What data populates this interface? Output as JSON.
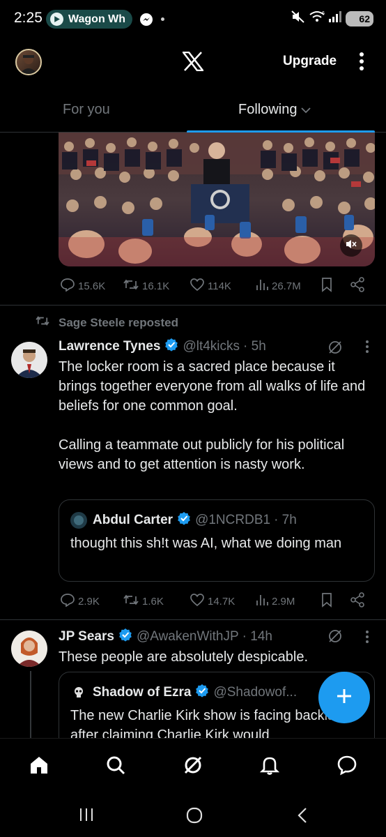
{
  "status_bar": {
    "time": "2:25",
    "app_pill_text": "Wagon Wh",
    "network": "6",
    "battery": "62"
  },
  "header": {
    "logo": "x-logo-icon",
    "upgrade_label": "Upgrade"
  },
  "tabs": [
    {
      "label": "For you",
      "active": false
    },
    {
      "label": "Following",
      "active": true
    }
  ],
  "post1": {
    "stats": {
      "replies": "15.6K",
      "reposts": "16.1K",
      "likes": "114K",
      "views": "26.7M"
    }
  },
  "post2": {
    "repost_label": "Sage Steele reposted",
    "name": "Lawrence Tynes",
    "handle": "@lt4kicks",
    "time": "· 5h",
    "text_p1": "The locker room is a sacred place because it brings together everyone from all walks of life and beliefs for one common goal.",
    "text_p2": "Calling a teammate out publicly for his political views and to get attention is nasty work.",
    "quote": {
      "name": "Abdul Carter",
      "handle": "@1NCRDB1",
      "time": "· 7h",
      "text": "thought this sh!t was AI, what we doing man"
    },
    "stats": {
      "replies": "2.9K",
      "reposts": "1.6K",
      "likes": "14.7K",
      "views": "2.9M"
    }
  },
  "post3": {
    "name": "JP Sears",
    "handle": "@AwakenWithJP",
    "time": "· 14h",
    "text": "These people are absolutely despicable.",
    "quote": {
      "name": "Shadow of Ezra",
      "handle": "@Shadowof...",
      "text": "The new Charlie Kirk show is facing backlash after claiming Charlie Kirk would"
    }
  },
  "colors": {
    "accent": "#1d9bf0",
    "text": "#e7e9ea",
    "muted": "#71767b",
    "divider": "#2f3336"
  }
}
